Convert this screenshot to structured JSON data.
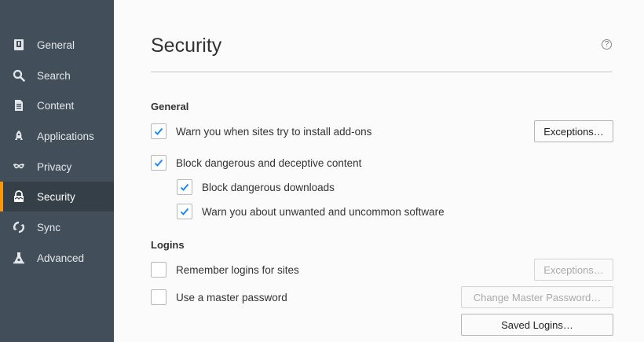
{
  "sidebar": {
    "items": [
      {
        "label": "General",
        "icon": "general-icon",
        "selected": false
      },
      {
        "label": "Search",
        "icon": "search-icon",
        "selected": false
      },
      {
        "label": "Content",
        "icon": "content-icon",
        "selected": false
      },
      {
        "label": "Applications",
        "icon": "applications-icon",
        "selected": false
      },
      {
        "label": "Privacy",
        "icon": "privacy-icon",
        "selected": false
      },
      {
        "label": "Security",
        "icon": "security-icon",
        "selected": true
      },
      {
        "label": "Sync",
        "icon": "sync-icon",
        "selected": false
      },
      {
        "label": "Advanced",
        "icon": "advanced-icon",
        "selected": false
      }
    ],
    "accent_color": "#ff9500"
  },
  "page": {
    "title": "Security",
    "help_glyph": "?"
  },
  "general": {
    "title": "General",
    "addons": {
      "label": "Warn you when sites try to install add-ons",
      "checked": true
    },
    "addons_exceptions": "Exceptions…",
    "block_dangerous": {
      "label": "Block dangerous and deceptive content",
      "checked": true
    },
    "block_downloads": {
      "label": "Block dangerous downloads",
      "checked": true
    },
    "warn_unwanted": {
      "label": "Warn you about unwanted and uncommon software",
      "checked": true
    }
  },
  "logins": {
    "title": "Logins",
    "remember": {
      "label": "Remember logins for sites",
      "checked": false
    },
    "remember_exceptions": "Exceptions…",
    "master": {
      "label": "Use a master password",
      "checked": false
    },
    "change_master": "Change Master Password…",
    "saved_logins": "Saved Logins…"
  },
  "colors": {
    "check": "#0a84ff"
  }
}
